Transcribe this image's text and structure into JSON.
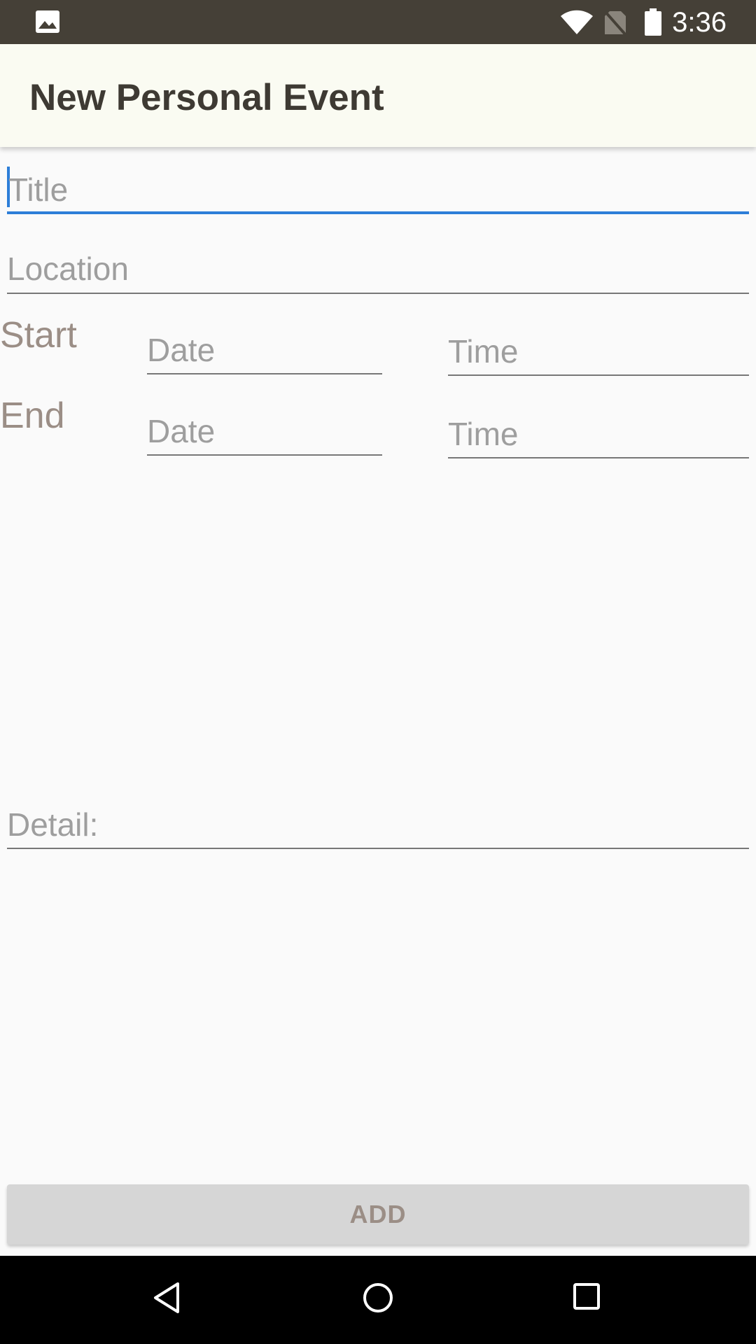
{
  "status_bar": {
    "time": "3:36",
    "icons": [
      "image-icon",
      "wifi-icon",
      "no-sim-icon",
      "battery-icon"
    ]
  },
  "app_bar": {
    "title": "New Personal Event"
  },
  "form": {
    "title_placeholder": "Title",
    "location_placeholder": "Location",
    "start_label": "Start",
    "end_label": "End",
    "start_date_placeholder": "Date",
    "start_time_placeholder": "Time",
    "end_date_placeholder": "Date",
    "end_time_placeholder": "Time",
    "detail_placeholder": "Detail:"
  },
  "actions": {
    "add_label": "ADD"
  },
  "nav_bar": {
    "icons": [
      "back-icon",
      "home-icon",
      "recents-icon"
    ]
  },
  "colors": {
    "status_bar": "#454037",
    "app_bar": "#fafbf2",
    "accent": "#2d7ed8",
    "label": "#9b8e86",
    "button": "#d6d6d6"
  }
}
